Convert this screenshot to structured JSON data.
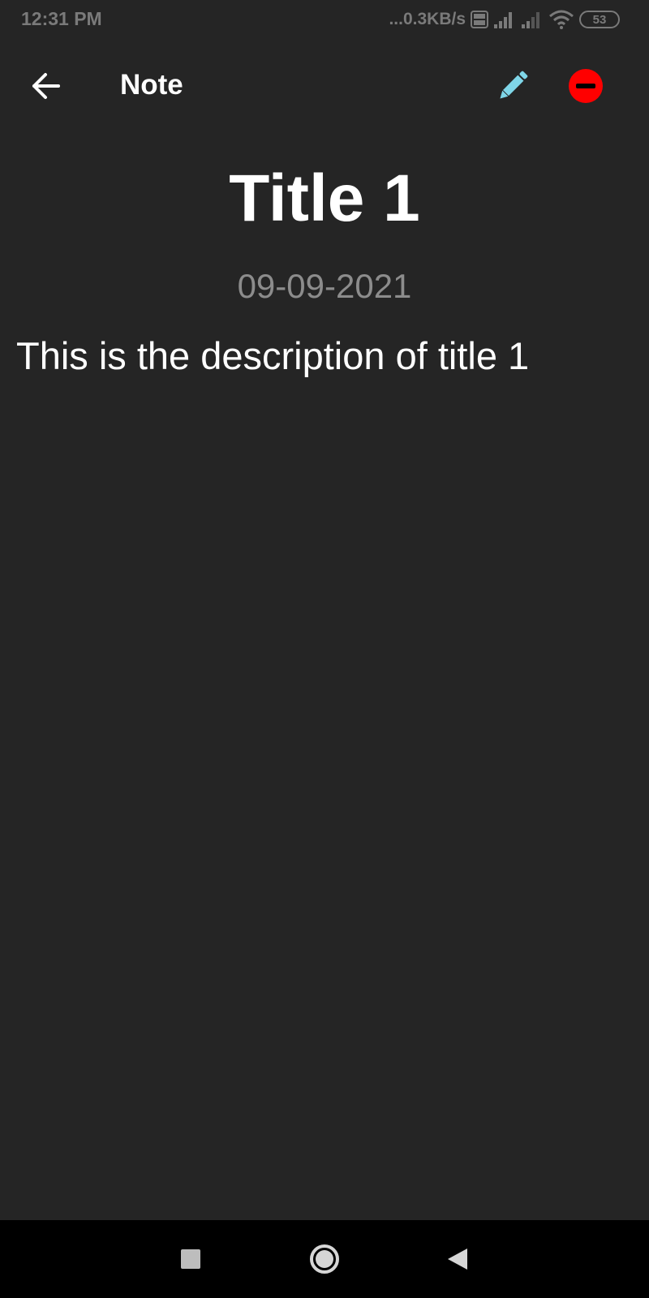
{
  "status_bar": {
    "time": "12:31 PM",
    "network_speed": "...0.3KB/s",
    "battery_level": "53",
    "icons": [
      "volte-icon",
      "signal-icon",
      "signal-secondary-icon",
      "wifi-icon",
      "battery-icon"
    ]
  },
  "app_bar": {
    "title": "Note",
    "back_icon": "arrow-left-icon",
    "edit_icon": "pencil-icon",
    "delete_icon": "minus-circle-icon",
    "edit_color": "#7fd6e8",
    "delete_color": "#ff0000"
  },
  "note": {
    "title": "Title 1",
    "date": "09-09-2021",
    "description": "This is the description of title 1"
  },
  "nav_bar": {
    "icons": [
      "recents-square-icon",
      "home-circle-icon",
      "back-triangle-icon"
    ]
  },
  "colors": {
    "background": "#252525",
    "nav_background": "#000000",
    "text_primary": "#ffffff",
    "text_secondary": "#8c8c8c"
  }
}
